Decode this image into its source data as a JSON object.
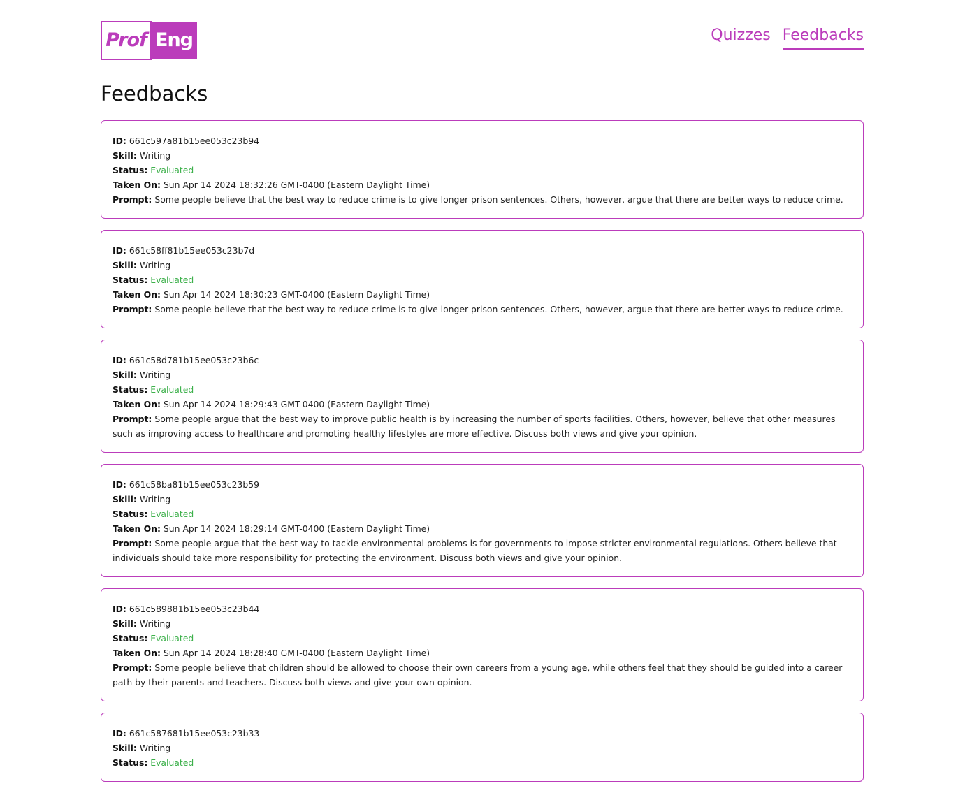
{
  "header": {
    "logo": {
      "left": "Prof",
      "right": "Eng"
    },
    "nav": [
      {
        "label": "Quizzes",
        "active": false
      },
      {
        "label": "Feedbacks",
        "active": true
      }
    ]
  },
  "page_title": "Feedbacks",
  "labels": {
    "id": "ID:",
    "skill": "Skill:",
    "status": "Status:",
    "taken_on": "Taken On:",
    "prompt": "Prompt:"
  },
  "colors": {
    "accent": "#bb3cbb",
    "status_evaluated": "#3cb04a"
  },
  "feedbacks": [
    {
      "id": "661c597a81b15ee053c23b94",
      "skill": "Writing",
      "status": "Evaluated",
      "taken_on": "Sun Apr 14 2024 18:32:26 GMT-0400 (Eastern Daylight Time)",
      "prompt": "Some people believe that the best way to reduce crime is to give longer prison sentences. Others, however, argue that there are better ways to reduce crime."
    },
    {
      "id": "661c58ff81b15ee053c23b7d",
      "skill": "Writing",
      "status": "Evaluated",
      "taken_on": "Sun Apr 14 2024 18:30:23 GMT-0400 (Eastern Daylight Time)",
      "prompt": "Some people believe that the best way to reduce crime is to give longer prison sentences. Others, however, argue that there are better ways to reduce crime."
    },
    {
      "id": "661c58d781b15ee053c23b6c",
      "skill": "Writing",
      "status": "Evaluated",
      "taken_on": "Sun Apr 14 2024 18:29:43 GMT-0400 (Eastern Daylight Time)",
      "prompt": "Some people argue that the best way to improve public health is by increasing the number of sports facilities. Others, however, believe that other measures such as improving access to healthcare and promoting healthy lifestyles are more effective. Discuss both views and give your opinion."
    },
    {
      "id": "661c58ba81b15ee053c23b59",
      "skill": "Writing",
      "status": "Evaluated",
      "taken_on": "Sun Apr 14 2024 18:29:14 GMT-0400 (Eastern Daylight Time)",
      "prompt": "Some people argue that the best way to tackle environmental problems is for governments to impose stricter environmental regulations. Others believe that individuals should take more responsibility for protecting the environment. Discuss both views and give your opinion."
    },
    {
      "id": "661c589881b15ee053c23b44",
      "skill": "Writing",
      "status": "Evaluated",
      "taken_on": "Sun Apr 14 2024 18:28:40 GMT-0400 (Eastern Daylight Time)",
      "prompt": "Some people believe that children should be allowed to choose their own careers from a young age, while others feel that they should be guided into a career path by their parents and teachers. Discuss both views and give your own opinion."
    },
    {
      "id": "661c587681b15ee053c23b33",
      "skill": "Writing",
      "status": "Evaluated"
    }
  ]
}
